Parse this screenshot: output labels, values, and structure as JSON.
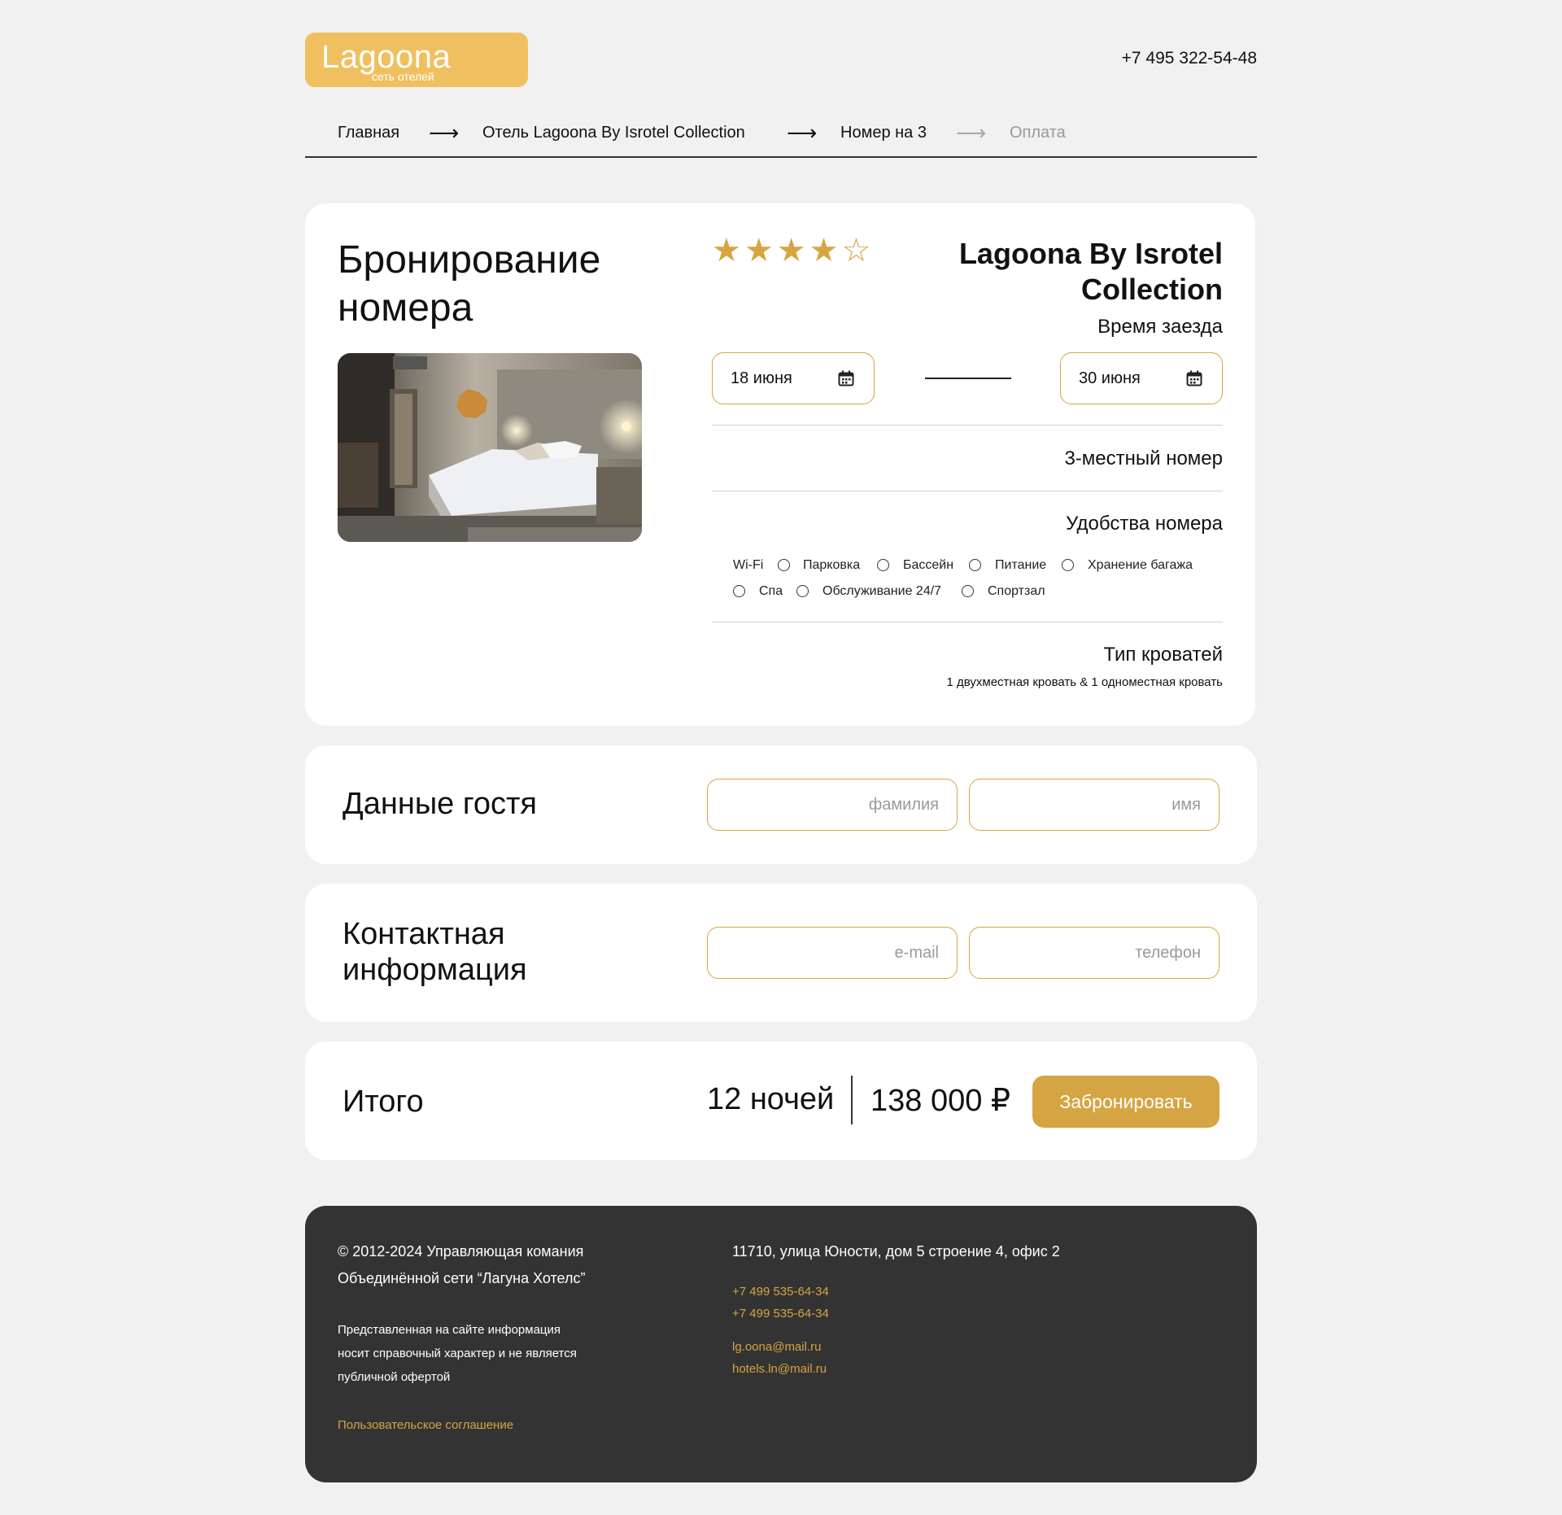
{
  "header": {
    "logo_name": "Lagoona",
    "logo_sub": "сеть отелей",
    "phone": "+7 495 322-54-48"
  },
  "breadcrumb": {
    "items": [
      "Главная",
      "Отель Lagoona By Isrotel Collection",
      "Номер на 3",
      "Оплата"
    ]
  },
  "booking": {
    "title_line1": "Бронирование",
    "title_line2": "номера",
    "rating": 4,
    "rating_max": 5,
    "hotel_name_line1": "Lagoona By Isrotel",
    "hotel_name_line2": "Collection",
    "checkin_label": "Время заезда",
    "date_from": "18 июня",
    "date_to": "30 июня",
    "room_type": "3-местный номер",
    "amenities_label": "Удобства номера",
    "amenities": [
      "Wi-Fi",
      "Парковка",
      "Бассейн",
      "Питание",
      "Хранение багажа",
      "Спа",
      "Обслуживание 24/7",
      "Спортзал"
    ],
    "beds_label": "Тип кроватей",
    "beds_value": "1 двухместная кровать & 1 одноместная кровать"
  },
  "guest": {
    "title": "Данные гостя",
    "lastname_placeholder": "фамилия",
    "firstname_placeholder": "имя"
  },
  "contact": {
    "title_line1": "Контактная",
    "title_line2": "информация",
    "email_placeholder": "e-mail",
    "phone_placeholder": "телефон"
  },
  "total": {
    "title": "Итого",
    "nights": "12 ночей",
    "price": "138 000 ₽",
    "book_label": "Забронировать"
  },
  "footer": {
    "copyright_line1": "© 2012-2024 Управляющая комания",
    "copyright_line2": "Объединённой сети “Лагуна Хотелс”",
    "disclaimer_line1": "Представленная на сайте информация",
    "disclaimer_line2": "носит справочный характер и не является",
    "disclaimer_line3": "публичной офертой",
    "agreement": "Пользовательское соглашение",
    "address": "11710, улица Юности, дом 5 строение 4, офис 2",
    "phone1": "+7 499 535-64-34",
    "phone2": "+7 499 535-64-34",
    "email1": "lg.oona@mail.ru",
    "email2": "hotels.ln@mail.ru"
  },
  "colors": {
    "accent": "#d6a543",
    "logo_bg": "#f0c060",
    "page_bg": "#f1f1f1",
    "footer_bg": "#333333"
  }
}
